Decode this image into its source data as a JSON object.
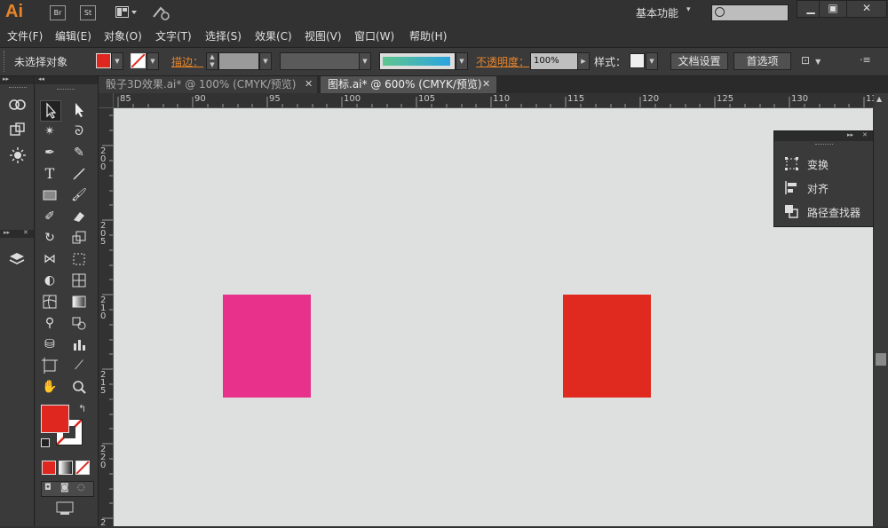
{
  "app": {
    "logo": "Ai",
    "bridge_label": "Br",
    "stock_label": "St",
    "workspace": "基本功能",
    "window_buttons": [
      "▁",
      "▣",
      "✕"
    ]
  },
  "menu": [
    "文件(F)",
    "编辑(E)",
    "对象(O)",
    "文字(T)",
    "选择(S)",
    "效果(C)",
    "视图(V)",
    "窗口(W)",
    "帮助(H)"
  ],
  "control": {
    "selection_status": "未选择对象",
    "stroke_label": "描边：",
    "opacity_label": "不透明度：",
    "opacity_value": "100%",
    "style_label": "样式：",
    "doc_setup": "文档设置",
    "preferences": "首选项",
    "fill_color": "#e0271f"
  },
  "tabs": [
    {
      "label": "骰子3D效果.ai* @ 100% (CMYK/预览)",
      "active": false
    },
    {
      "label": "图标.ai* @ 600% (CMYK/预览)",
      "active": true
    }
  ],
  "ruler": {
    "top": [
      "85",
      "90",
      "95",
      "100",
      "105",
      "110",
      "115",
      "120",
      "125",
      "130",
      "13"
    ],
    "left": [
      [
        "2",
        "0",
        "0"
      ],
      [
        "2",
        "0",
        "5"
      ],
      [
        "2",
        "1",
        "0"
      ],
      [
        "2",
        "1",
        "5"
      ],
      [
        "2",
        "2",
        "0"
      ],
      [
        "2"
      ]
    ]
  },
  "floating_panel": {
    "items": [
      "变换",
      "对齐",
      "路径查找器"
    ]
  },
  "artboard": {
    "shape1_color": "#e8318a",
    "shape2_color": "#e02a20"
  }
}
